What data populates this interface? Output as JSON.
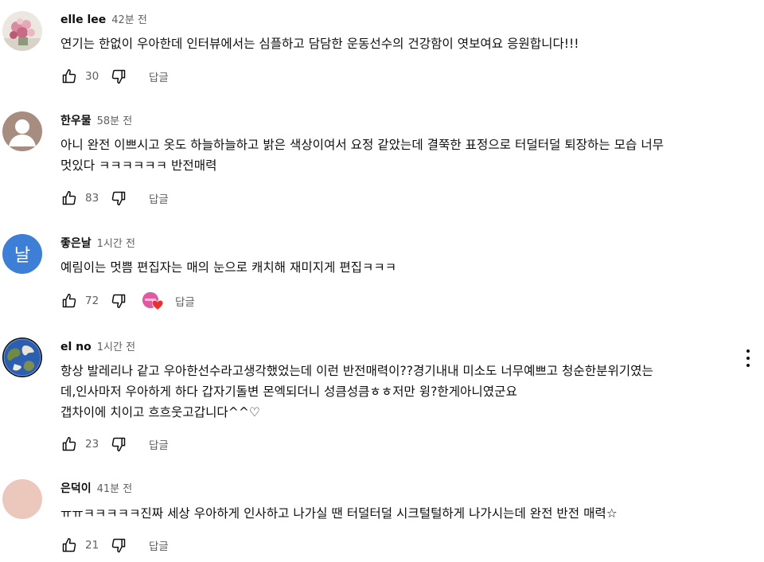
{
  "comments": [
    {
      "author": "elle lee",
      "time": "42분 전",
      "text": "연기는 한없이 우아한데 인터뷰에서는 심플하고 담담한 운동선수의 건강함이 엿보여요 응원합니다!!!",
      "likes": "30",
      "reply_label": "답글",
      "avatar_icon": "flower-photo"
    },
    {
      "author": "한우물",
      "time": "58분 전",
      "text": "아니 완전 이쁘시고 옷도 하늘하늘하고 밝은 색상이여서 요정 같았는데 결쭉한 표정으로 터덜터덜 퇴장하는 모습 너무\n멋있다 ㅋㅋㅋㅋㅋㅋ 반전매력",
      "likes": "83",
      "reply_label": "답글",
      "avatar_icon": "default-person"
    },
    {
      "author": "좋은날",
      "time": "1시간 전",
      "text": "예림이는 멋쁨 편집자는 매의 눈으로 캐치해 재미지게 편집ㅋㅋㅋ",
      "likes": "72",
      "reply_label": "답글",
      "avatar_letter": "날",
      "avatar_color": "#3d7fd6",
      "creator_heart": true
    },
    {
      "author": "el no",
      "time": "1시간 전",
      "text": "항상 발레리나 같고 우아한선수라고생각했었는데 이런 반전매력이??경기내내 미소도 너무예쁘고 청순한분위기였는\n데,인사마저 우아하게 하다 갑자기돌변 몬엑되더니 성큼성큼ㅎㅎ저만 윙?한게아니였군요\n갭차이에 치이고 흐흐웃고갑니다^^♡",
      "likes": "23",
      "reply_label": "답글",
      "avatar_icon": "earth-photo",
      "has_menu": true
    },
    {
      "author": "은덕이",
      "time": "41분 전",
      "text": "ㅠㅠㅋㅋㅋㅋㅋ진짜 세상 우아하게 인사하고 나가실 땐 터덜터덜 시크털털하게 나가시는데 완전 반전 매력☆",
      "likes": "21",
      "reply_label": "답글",
      "avatar_color": "#ecc7bb"
    }
  ],
  "colors": {
    "text_primary": "#0f0f0f",
    "text_secondary": "#606060",
    "heart": "#e8302f"
  }
}
